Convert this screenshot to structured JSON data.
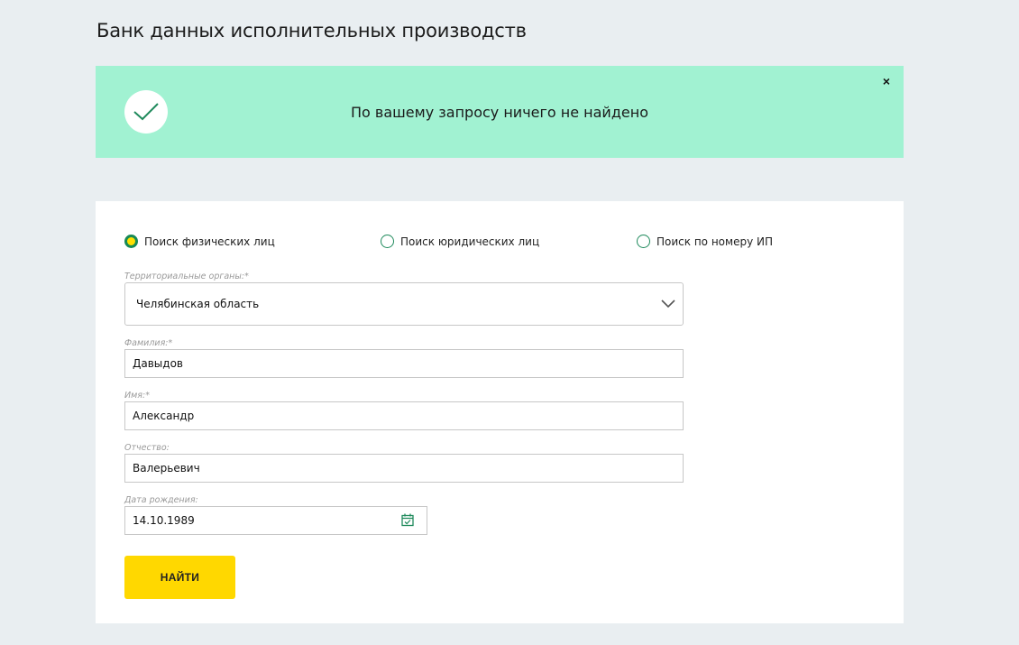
{
  "page": {
    "title": "Банк данных исполнительных производств"
  },
  "notice": {
    "message": "По вашему запросу ничего не найдено",
    "close_label": "×",
    "icon": "check-icon",
    "background": "#a1f2d2"
  },
  "search_type": {
    "options": [
      {
        "label": "Поиск физических лиц",
        "checked": true
      },
      {
        "label": "Поиск юридических лиц",
        "checked": false
      },
      {
        "label": "Поиск по номеру ИП",
        "checked": false
      }
    ]
  },
  "form": {
    "territory": {
      "label": "Территориальные органы:*",
      "value": "Челябинская область"
    },
    "surname": {
      "label": "Фамилия:*",
      "value": "Давыдов"
    },
    "name": {
      "label": "Имя:*",
      "value": "Александр"
    },
    "patronymic": {
      "label": "Отчество:",
      "value": "Валерьевич"
    },
    "birth_date": {
      "label": "Дата рождения:",
      "value": "14.10.1989",
      "icon": "calendar-icon"
    },
    "submit_label": "НАЙТИ"
  },
  "colors": {
    "accent": "#178a55",
    "button": "#ffd800",
    "page_bg": "#e9eef1"
  }
}
